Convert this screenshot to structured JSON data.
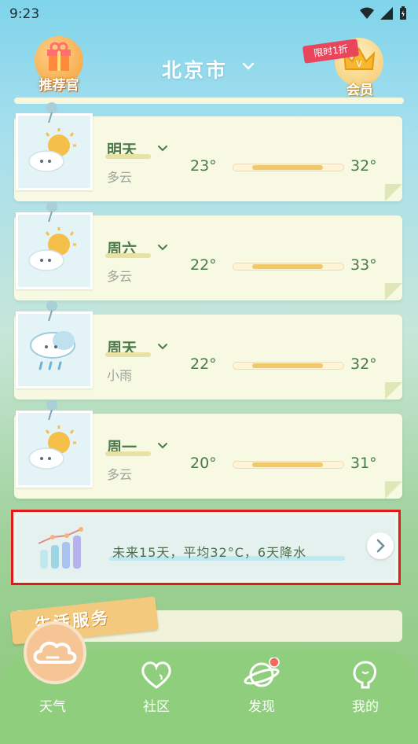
{
  "status": {
    "time": "9:23"
  },
  "header": {
    "left_badge": "推荐官",
    "city": "北京市",
    "vip_ribbon": "限时1折",
    "vip_label": "会员"
  },
  "days": [
    {
      "day": "明天",
      "condition": "多云",
      "low": "23°",
      "high": "32°",
      "icon": "partly-cloudy-icon"
    },
    {
      "day": "周六",
      "condition": "多云",
      "low": "22°",
      "high": "33°",
      "icon": "partly-cloudy-icon"
    },
    {
      "day": "周天",
      "condition": "小雨",
      "low": "22°",
      "high": "32°",
      "icon": "light-rain-icon"
    },
    {
      "day": "周一",
      "condition": "多云",
      "low": "20°",
      "high": "31°",
      "icon": "partly-cloudy-icon"
    }
  ],
  "forecast": {
    "text": "未来15天，平均32°C，6天降水"
  },
  "life": {
    "title": "生活服务"
  },
  "tabs": [
    {
      "label": "天气",
      "icon": "weather-cloud-icon"
    },
    {
      "label": "社区",
      "icon": "heart-chat-icon"
    },
    {
      "label": "发现",
      "icon": "planet-icon"
    },
    {
      "label": "我的",
      "icon": "profile-icon"
    }
  ],
  "colors": {
    "accent_green": "#4a7a4a",
    "tab_bar": "#8fce7c",
    "highlight_border": "#e31919"
  }
}
